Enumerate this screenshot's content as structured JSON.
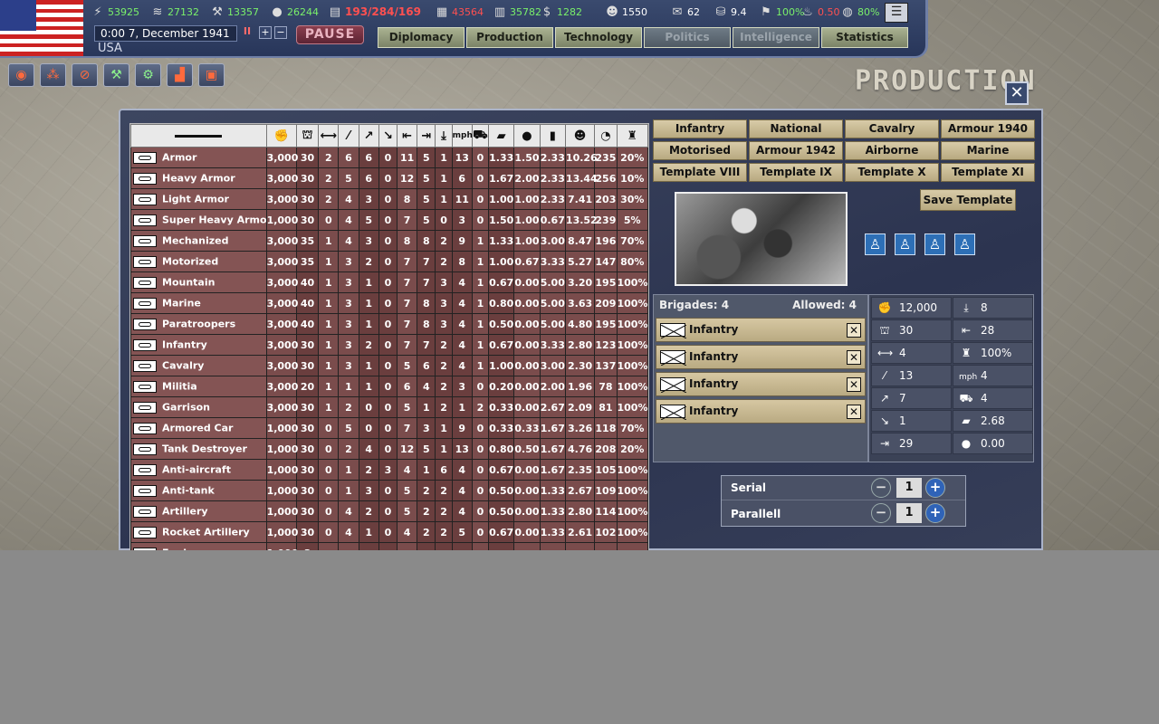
{
  "topbar": {
    "resources": [
      {
        "icon": "energy-icon",
        "value": "53925",
        "color": "green"
      },
      {
        "icon": "metal-icon",
        "value": "27132",
        "color": "green"
      },
      {
        "icon": "rare-materials-icon",
        "value": "13357",
        "color": "green"
      },
      {
        "icon": "oil-icon",
        "value": "26244",
        "color": "green"
      },
      {
        "icon": "manpower-divisions-icon",
        "value": "193/284/169",
        "color": "red"
      },
      {
        "icon": "supplies-icon",
        "value": "43564",
        "color": "red"
      },
      {
        "icon": "fuel-icon",
        "value": "35782",
        "color": "green"
      },
      {
        "icon": "money-icon",
        "value": "1282",
        "color": "green"
      },
      {
        "icon": "manpower-icon",
        "value": "1550",
        "color": "white"
      },
      {
        "icon": "diplomacy-icon",
        "value": "62",
        "color": "white"
      },
      {
        "icon": "dissent-icon",
        "value": "9.4",
        "color": "white"
      },
      {
        "icon": "national-unity-icon",
        "value": "100%",
        "color": "green"
      },
      {
        "icon": "war-exhaustion-icon",
        "value": "0.50",
        "color": "red"
      },
      {
        "icon": "neutrality-icon",
        "value": "80%",
        "color": "green"
      }
    ],
    "date": "0:00 7, December 1941",
    "country": "USA",
    "pause_label": "PAUSE",
    "tabs": [
      "Diplomacy",
      "Production",
      "Technology",
      "Politics",
      "Intelligence",
      "Statistics"
    ]
  },
  "production": {
    "title": "PRODUCTION",
    "table_header_icons": [
      "divider",
      "manpower",
      "supply-org",
      "speed",
      "soft-attack",
      "hard-attack",
      "air-attack",
      "defense",
      "toughness",
      "air-defense",
      "speed-mph",
      "transport",
      "fuel",
      "oil-drop",
      "ic",
      "cost",
      "time",
      "unit"
    ],
    "rows": [
      {
        "name": "Armor",
        "cells": [
          "3,000",
          "30",
          "2",
          "6",
          "6",
          "0",
          "11",
          "5",
          "1",
          "13",
          "0",
          "1.33",
          "1.50",
          "2.33",
          "10.26",
          "235",
          "20%"
        ]
      },
      {
        "name": "Heavy Armor",
        "cells": [
          "3,000",
          "30",
          "2",
          "5",
          "6",
          "0",
          "12",
          "5",
          "1",
          "6",
          "0",
          "1.67",
          "2.00",
          "2.33",
          "13.44",
          "256",
          "10%"
        ]
      },
      {
        "name": "Light Armor",
        "cells": [
          "3,000",
          "30",
          "2",
          "4",
          "3",
          "0",
          "8",
          "5",
          "1",
          "11",
          "0",
          "1.00",
          "1.00",
          "2.33",
          "7.41",
          "203",
          "30%"
        ]
      },
      {
        "name": "Super Heavy Armored",
        "cells": [
          "1,000",
          "30",
          "0",
          "4",
          "5",
          "0",
          "7",
          "5",
          "0",
          "3",
          "0",
          "1.50",
          "1.00",
          "0.67",
          "13.52",
          "239",
          "5%"
        ]
      },
      {
        "name": "Mechanized",
        "cells": [
          "3,000",
          "35",
          "1",
          "4",
          "3",
          "0",
          "8",
          "8",
          "2",
          "9",
          "1",
          "1.33",
          "1.00",
          "3.00",
          "8.47",
          "196",
          "70%"
        ]
      },
      {
        "name": "Motorized",
        "cells": [
          "3,000",
          "35",
          "1",
          "3",
          "2",
          "0",
          "7",
          "7",
          "2",
          "8",
          "1",
          "1.00",
          "0.67",
          "3.33",
          "5.27",
          "147",
          "80%"
        ]
      },
      {
        "name": "Mountain",
        "cells": [
          "3,000",
          "40",
          "1",
          "3",
          "1",
          "0",
          "7",
          "7",
          "3",
          "4",
          "1",
          "0.67",
          "0.00",
          "5.00",
          "3.20",
          "195",
          "100%"
        ]
      },
      {
        "name": "Marine",
        "cells": [
          "3,000",
          "40",
          "1",
          "3",
          "1",
          "0",
          "7",
          "8",
          "3",
          "4",
          "1",
          "0.80",
          "0.00",
          "5.00",
          "3.63",
          "209",
          "100%"
        ]
      },
      {
        "name": "Paratroopers",
        "cells": [
          "3,000",
          "40",
          "1",
          "3",
          "1",
          "0",
          "7",
          "8",
          "3",
          "4",
          "1",
          "0.50",
          "0.00",
          "5.00",
          "4.80",
          "195",
          "100%"
        ]
      },
      {
        "name": "Infantry",
        "cells": [
          "3,000",
          "30",
          "1",
          "3",
          "2",
          "0",
          "7",
          "7",
          "2",
          "4",
          "1",
          "0.67",
          "0.00",
          "3.33",
          "2.80",
          "123",
          "100%"
        ]
      },
      {
        "name": "Cavalry",
        "cells": [
          "3,000",
          "30",
          "1",
          "3",
          "1",
          "0",
          "5",
          "6",
          "2",
          "4",
          "1",
          "1.00",
          "0.00",
          "3.00",
          "2.30",
          "137",
          "100%"
        ]
      },
      {
        "name": "Militia",
        "cells": [
          "3,000",
          "20",
          "1",
          "1",
          "1",
          "0",
          "6",
          "4",
          "2",
          "3",
          "0",
          "0.20",
          "0.00",
          "2.00",
          "1.96",
          "78",
          "100%"
        ]
      },
      {
        "name": "Garrison",
        "cells": [
          "3,000",
          "30",
          "1",
          "2",
          "0",
          "0",
          "5",
          "1",
          "2",
          "1",
          "2",
          "0.33",
          "0.00",
          "2.67",
          "2.09",
          "81",
          "100%"
        ]
      },
      {
        "name": "Armored Car",
        "cells": [
          "1,000",
          "30",
          "0",
          "5",
          "0",
          "0",
          "7",
          "3",
          "1",
          "9",
          "0",
          "0.33",
          "0.33",
          "1.67",
          "3.26",
          "118",
          "70%"
        ]
      },
      {
        "name": "Tank Destroyer",
        "cells": [
          "1,000",
          "30",
          "0",
          "2",
          "4",
          "0",
          "12",
          "5",
          "1",
          "13",
          "0",
          "0.80",
          "0.50",
          "1.67",
          "4.76",
          "208",
          "20%"
        ]
      },
      {
        "name": "Anti-aircraft",
        "cells": [
          "1,000",
          "30",
          "0",
          "1",
          "2",
          "3",
          "4",
          "1",
          "6",
          "4",
          "0",
          "0.67",
          "0.00",
          "1.67",
          "2.35",
          "105",
          "100%"
        ]
      },
      {
        "name": "Anti-tank",
        "cells": [
          "1,000",
          "30",
          "0",
          "1",
          "3",
          "0",
          "5",
          "2",
          "2",
          "4",
          "0",
          "0.50",
          "0.00",
          "1.33",
          "2.67",
          "109",
          "100%"
        ]
      },
      {
        "name": "Artillery",
        "cells": [
          "1,000",
          "30",
          "0",
          "4",
          "2",
          "0",
          "5",
          "2",
          "2",
          "4",
          "0",
          "0.50",
          "0.00",
          "1.33",
          "2.80",
          "114",
          "100%"
        ]
      },
      {
        "name": "Rocket Artillery",
        "cells": [
          "1,000",
          "30",
          "0",
          "4",
          "1",
          "0",
          "4",
          "2",
          "2",
          "5",
          "0",
          "0.67",
          "0.00",
          "1.33",
          "2.61",
          "102",
          "100%"
        ]
      },
      {
        "name": "Engineers",
        "cells": [
          "1,000",
          "3",
          "",
          "",
          "",
          "",
          "",
          "",
          "",
          "",
          "",
          "",
          "",
          "",
          "",
          "",
          ""
        ]
      }
    ],
    "template_buttons": [
      "Infantry",
      "National Guard",
      "Cavalry",
      "Armour 1940",
      "Motorised",
      "Armour 1942",
      "Airborne",
      "Marine",
      "Template VIII",
      "Template IX",
      "Template X",
      "Template XI"
    ],
    "save_template": "Save Template",
    "brigades_label": "Brigades:  4",
    "allowed_label": "Allowed:  4",
    "brigades": [
      "Infantry",
      "Infantry",
      "Infantry",
      "Infantry"
    ],
    "stats": [
      {
        "icon": "manpower-icon",
        "value": "12,000"
      },
      {
        "icon": "air-defense-icon",
        "value": "8"
      },
      {
        "icon": "organization-icon",
        "value": "30"
      },
      {
        "icon": "defense-icon",
        "value": "28"
      },
      {
        "icon": "width-icon",
        "value": "4"
      },
      {
        "icon": "unit-icon",
        "value": "100%"
      },
      {
        "icon": "soft-attack-icon",
        "value": "13"
      },
      {
        "icon": "speed-mph-icon",
        "value": "4"
      },
      {
        "icon": "hard-attack-icon",
        "value": "7"
      },
      {
        "icon": "transport-icon",
        "value": "4"
      },
      {
        "icon": "air-attack-icon",
        "value": "1"
      },
      {
        "icon": "supply-icon",
        "value": "2.68"
      },
      {
        "icon": "toughness-icon",
        "value": "29"
      },
      {
        "icon": "fuel-icon",
        "value": "0.00"
      }
    ],
    "serial_label": "Serial",
    "serial_value": "1",
    "parallel_label": "Parallell",
    "parallel_value": "1"
  }
}
